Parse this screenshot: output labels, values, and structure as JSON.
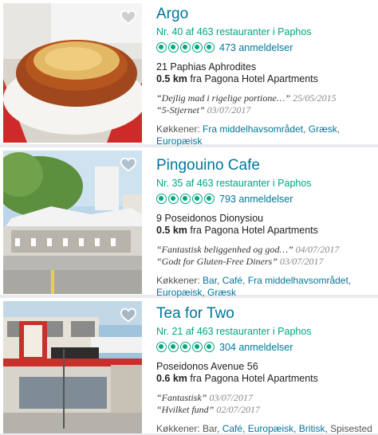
{
  "restaurants": [
    {
      "name": "Argo",
      "rank": "Nr. 40 af 463 restauranter i Paphos",
      "bubbles": 5,
      "reviews": "473 anmeldelser",
      "address": "21 Paphias Aphrodites",
      "distance": "0.5 km",
      "distance_suffix": " fra Pagona Hotel Apartments",
      "quotes": [
        {
          "text": "“Dejlig mad i rigelige portione…”",
          "date": "25/05/2015"
        },
        {
          "text": "“5-Stjernet”",
          "date": "03/07/2017"
        }
      ],
      "cuisine_label": "Køkkener: ",
      "cuisines": [
        "Fra middelhavsområdet",
        "Græsk",
        "Europæisk"
      ]
    },
    {
      "name": "Pingouino Cafe",
      "rank": "Nr. 35 af 463 restauranter i Paphos",
      "bubbles": 5,
      "reviews": "793 anmeldelser",
      "address": "9 Poseidonos Dionysiou",
      "distance": "0.5 km",
      "distance_suffix": " fra Pagona Hotel Apartments",
      "quotes": [
        {
          "text": "“Fantastisk beliggenhed og god…”",
          "date": "04/07/2017"
        },
        {
          "text": "“Godt for Gluten-Free Diners”",
          "date": "03/07/2017"
        }
      ],
      "cuisine_label": "Køkkener: ",
      "cuisines": [
        "Bar",
        "Café",
        "Fra middelhavsområdet",
        "Europæisk",
        "Græsk"
      ]
    },
    {
      "name": "Tea for Two",
      "rank": "Nr. 21 af 463 restauranter i Paphos",
      "bubbles": 5,
      "reviews": "304 anmeldelser",
      "address": "Poseidonos Avenue 56",
      "distance": "0.6 km",
      "distance_suffix": " fra Pagona Hotel Apartments",
      "quotes": [
        {
          "text": "“Fantastisk”",
          "date": "03/07/2017"
        },
        {
          "text": "“Hvilket fund”",
          "date": "02/07/2017"
        }
      ],
      "cuisine_label": "Køkkener: ",
      "cuisines": [
        "Bar",
        "Café",
        "Europæisk",
        "Britisk",
        "Spisested"
      ]
    }
  ],
  "colors": {
    "accent_green": "#00a680",
    "link_blue": "#00769b"
  },
  "icons": {
    "favorite": "heart-outline-icon",
    "rating": "bubble-icon"
  }
}
